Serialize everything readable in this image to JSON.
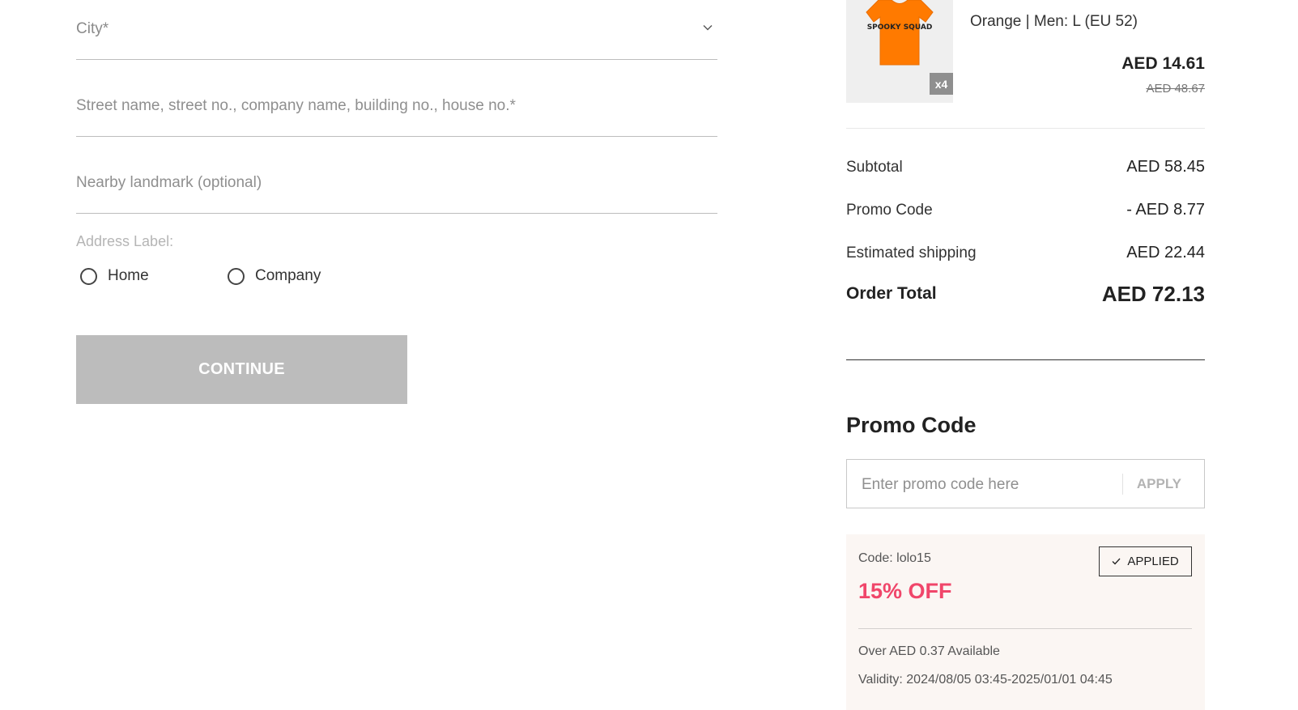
{
  "form": {
    "city_placeholder": "City*",
    "street_placeholder": "Street name, street no., company name, building no., house no.*",
    "landmark_placeholder": "Nearby landmark (optional)",
    "address_label": "Address Label:",
    "label_options": [
      "Home",
      "Company"
    ],
    "continue_label": "CONTINUE"
  },
  "product": {
    "variant": "Orange | Men: L (EU 52)",
    "quantity": "x4",
    "price": "AED 14.61",
    "original_price": "AED 48.67",
    "shirt_print": "SPOOKY SQUAD"
  },
  "summary": {
    "rows": [
      {
        "label": "Subtotal",
        "value": "AED 58.45"
      },
      {
        "label": "Promo Code",
        "value": "- AED 8.77"
      },
      {
        "label": "Estimated shipping",
        "value": "AED 22.44"
      }
    ],
    "total_label": "Order Total",
    "total_value": "AED 72.13"
  },
  "promo": {
    "title": "Promo Code",
    "input_placeholder": "Enter promo code here",
    "apply_label": "APPLY",
    "coupon": {
      "code": "Code: lolo15",
      "discount": "15% OFF",
      "applied_label": "APPLIED",
      "available": "Over AED 0.37 Available",
      "validity": "Validity: 2024/08/05 03:45-2025/01/01 04:45"
    }
  },
  "colors": {
    "accent_discount": "#f0466a",
    "button_disabled": "#bcbcbc",
    "coupon_bg": "#fbf6f3",
    "shirt": "#ff7a00"
  }
}
